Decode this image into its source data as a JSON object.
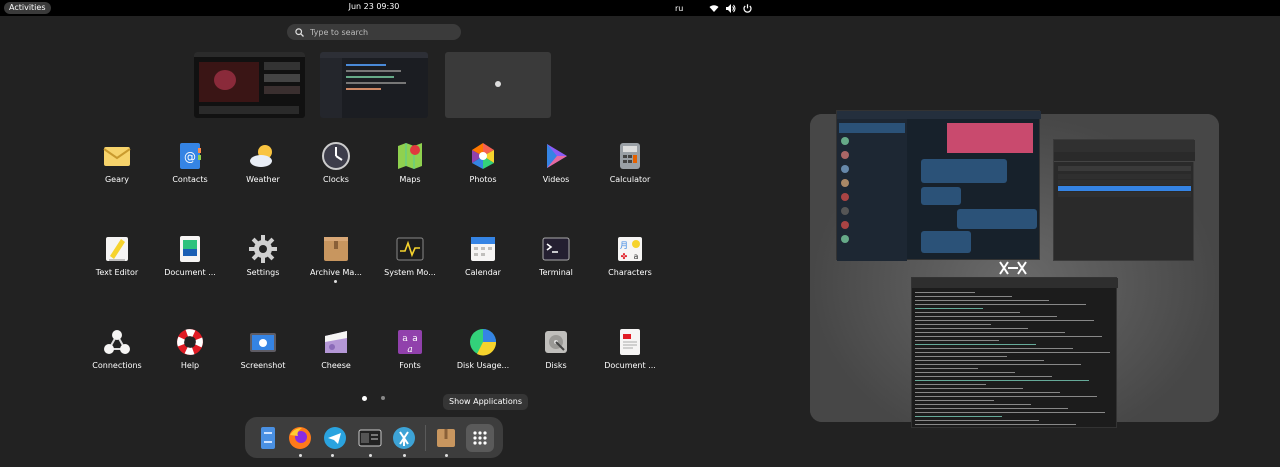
{
  "topbar": {
    "activities": "Activities",
    "datetime": "Jun 23  09:30",
    "keyboard_layout": "ru"
  },
  "search": {
    "placeholder": "Type to search"
  },
  "apps": [
    {
      "label": "Geary",
      "icon": "mail-icon"
    },
    {
      "label": "Contacts",
      "icon": "contacts-icon"
    },
    {
      "label": "Weather",
      "icon": "weather-icon"
    },
    {
      "label": "Clocks",
      "icon": "clock-icon"
    },
    {
      "label": "Maps",
      "icon": "maps-icon"
    },
    {
      "label": "Photos",
      "icon": "photos-icon"
    },
    {
      "label": "Videos",
      "icon": "videos-icon"
    },
    {
      "label": "Calculator",
      "icon": "calculator-icon"
    },
    {
      "label": "Text Editor",
      "icon": "text-editor-icon"
    },
    {
      "label": "Document ...",
      "icon": "document-viewer-icon"
    },
    {
      "label": "Settings",
      "icon": "gear-icon"
    },
    {
      "label": "Archive Ma...",
      "icon": "archive-icon"
    },
    {
      "label": "System Mo...",
      "icon": "system-monitor-icon"
    },
    {
      "label": "Calendar",
      "icon": "calendar-icon"
    },
    {
      "label": "Terminal",
      "icon": "terminal-icon"
    },
    {
      "label": "Characters",
      "icon": "characters-icon"
    },
    {
      "label": "Connections",
      "icon": "connections-icon"
    },
    {
      "label": "Help",
      "icon": "lifebuoy-icon"
    },
    {
      "label": "Screenshot",
      "icon": "screenshot-icon"
    },
    {
      "label": "Cheese",
      "icon": "cheese-icon"
    },
    {
      "label": "Fonts",
      "icon": "fonts-icon"
    },
    {
      "label": "Disk Usage...",
      "icon": "disk-usage-icon"
    },
    {
      "label": "Disks",
      "icon": "disks-icon"
    },
    {
      "label": "Document ...",
      "icon": "document-scanner-icon"
    }
  ],
  "tooltip": "Show Applications",
  "dock": [
    {
      "icon": "files-icon"
    },
    {
      "icon": "firefox-icon"
    },
    {
      "icon": "telegram-icon"
    },
    {
      "icon": "window-list-icon"
    },
    {
      "icon": "vscode-icon"
    },
    {
      "icon": "archive-icon"
    },
    {
      "icon": "app-grid-icon"
    }
  ],
  "colors": {
    "panel": "#000000",
    "overview": "#222222",
    "dock": "#3d3d3d",
    "accent": "#3584e4"
  }
}
